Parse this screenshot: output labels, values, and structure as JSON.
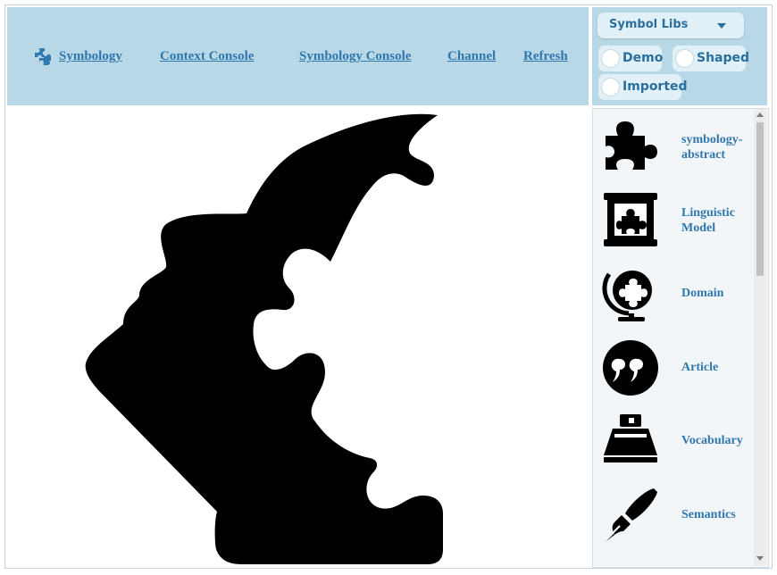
{
  "nav": {
    "links": [
      "Symbology",
      "Context Console",
      "Symbology Console",
      "Channel",
      "Refresh"
    ]
  },
  "symbol_libs": {
    "dropdown_label": "Symbol Libs",
    "radios": [
      "Demo",
      "Shaped",
      "Imported"
    ]
  },
  "symbols": [
    {
      "label": "symbology-abstract",
      "icon": "puzzle-piece-icon"
    },
    {
      "label": "Linguistic Model",
      "icon": "scroll-puzzle-icon"
    },
    {
      "label": "Domain",
      "icon": "globe-puzzle-icon"
    },
    {
      "label": "Article",
      "icon": "quote-icon"
    },
    {
      "label": "Vocabulary",
      "icon": "ink-stamp-icon"
    },
    {
      "label": "Semantics",
      "icon": "fountain-pen-icon"
    }
  ],
  "colors": {
    "header_bg": "#b8d8e8",
    "link": "#2f78ad",
    "pill_bg": "#e1eff7",
    "silhouette": "#000000"
  }
}
